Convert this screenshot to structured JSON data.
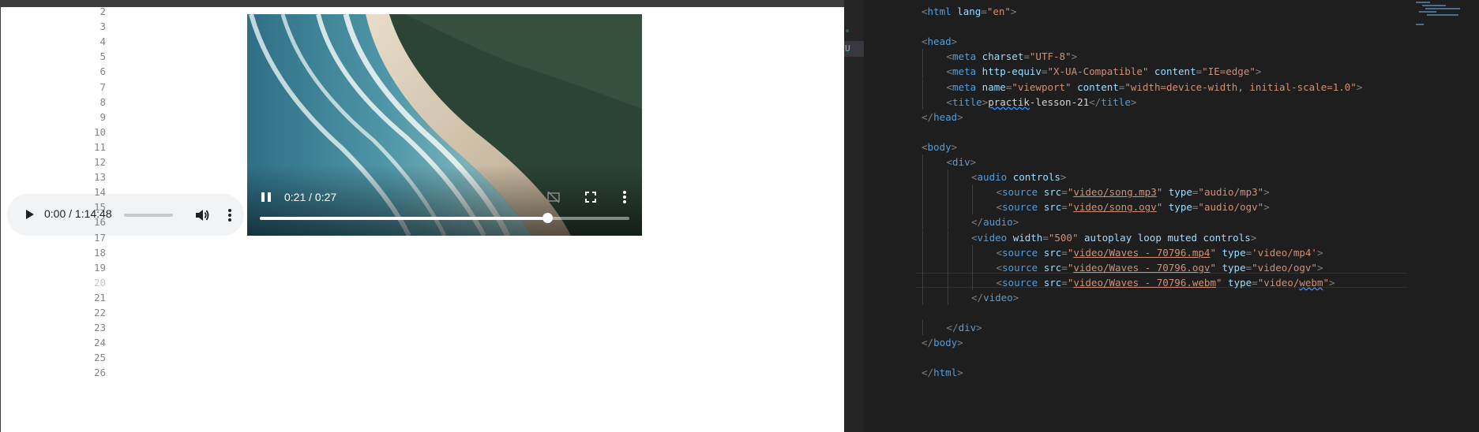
{
  "preview": {
    "audio": {
      "time": "0:00 / 1:14:48",
      "progress": 0
    },
    "video": {
      "time": "0:21 / 0:27",
      "progress": 0.7778
    }
  },
  "editor": {
    "gutter_badge": "U",
    "active_line": 20,
    "lines": [
      {
        "n": "2",
        "tokens": [
          [
            "br",
            "<"
          ],
          [
            "tag",
            "html"
          ],
          [
            "at",
            " lang"
          ],
          [
            "br",
            "="
          ],
          [
            "st",
            "\"en\""
          ],
          [
            "br",
            ">"
          ]
        ]
      },
      {
        "n": "3",
        "tokens": []
      },
      {
        "n": "4",
        "tokens": [
          [
            "br",
            "<"
          ],
          [
            "tag",
            "head"
          ],
          [
            "br",
            ">"
          ]
        ]
      },
      {
        "n": "5",
        "indent": 1,
        "tokens": [
          [
            "br",
            "<"
          ],
          [
            "tag",
            "meta"
          ],
          [
            "at",
            " charset"
          ],
          [
            "br",
            "="
          ],
          [
            "st",
            "\"UTF-8\""
          ],
          [
            "br",
            ">"
          ]
        ]
      },
      {
        "n": "6",
        "indent": 1,
        "tokens": [
          [
            "br",
            "<"
          ],
          [
            "tag",
            "meta"
          ],
          [
            "at",
            " http-equiv"
          ],
          [
            "br",
            "="
          ],
          [
            "st",
            "\"X-UA-Compatible\""
          ],
          [
            "at",
            " content"
          ],
          [
            "br",
            "="
          ],
          [
            "st",
            "\"IE=edge\""
          ],
          [
            "br",
            ">"
          ]
        ]
      },
      {
        "n": "7",
        "indent": 1,
        "tokens": [
          [
            "br",
            "<"
          ],
          [
            "tag",
            "meta"
          ],
          [
            "at",
            " name"
          ],
          [
            "br",
            "="
          ],
          [
            "st",
            "\"viewport\""
          ],
          [
            "at",
            " content"
          ],
          [
            "br",
            "="
          ],
          [
            "st",
            "\"width=device-width, initial-scale=1.0\""
          ],
          [
            "br",
            ">"
          ]
        ]
      },
      {
        "n": "8",
        "indent": 1,
        "tokens": [
          [
            "br",
            "<"
          ],
          [
            "tag",
            "title"
          ],
          [
            "br",
            ">"
          ],
          [
            "squig",
            "practik"
          ],
          [
            "txt",
            "-lesson-21"
          ],
          [
            "br",
            "</"
          ],
          [
            "tag",
            "title"
          ],
          [
            "br",
            ">"
          ]
        ]
      },
      {
        "n": "9",
        "tokens": [
          [
            "br",
            "</"
          ],
          [
            "tag",
            "head"
          ],
          [
            "br",
            ">"
          ]
        ]
      },
      {
        "n": "10",
        "tokens": []
      },
      {
        "n": "11",
        "tokens": [
          [
            "br",
            "<"
          ],
          [
            "tag",
            "body"
          ],
          [
            "br",
            ">"
          ]
        ]
      },
      {
        "n": "12",
        "indent": 1,
        "tokens": [
          [
            "br",
            "<"
          ],
          [
            "tag",
            "div"
          ],
          [
            "br",
            ">"
          ]
        ]
      },
      {
        "n": "13",
        "indent": 2,
        "tokens": [
          [
            "br",
            "<"
          ],
          [
            "tag",
            "audio"
          ],
          [
            "at",
            " controls"
          ],
          [
            "br",
            ">"
          ]
        ]
      },
      {
        "n": "14",
        "indent": 3,
        "tokens": [
          [
            "br",
            "<"
          ],
          [
            "tag",
            "source"
          ],
          [
            "at",
            " src"
          ],
          [
            "br",
            "="
          ],
          [
            "st",
            "\""
          ],
          [
            "link",
            "video/song.mp3"
          ],
          [
            "st",
            "\""
          ],
          [
            "at",
            " type"
          ],
          [
            "br",
            "="
          ],
          [
            "st",
            "\"audio/mp3\""
          ],
          [
            "br",
            ">"
          ]
        ]
      },
      {
        "n": "15",
        "indent": 3,
        "tokens": [
          [
            "br",
            "<"
          ],
          [
            "tag",
            "source"
          ],
          [
            "at",
            " src"
          ],
          [
            "br",
            "="
          ],
          [
            "st",
            "\""
          ],
          [
            "link",
            "video/song.ogv"
          ],
          [
            "st",
            "\""
          ],
          [
            "at",
            " type"
          ],
          [
            "br",
            "="
          ],
          [
            "st",
            "\"audio/ogv\""
          ],
          [
            "br",
            ">"
          ]
        ]
      },
      {
        "n": "16",
        "indent": 2,
        "tokens": [
          [
            "br",
            "</"
          ],
          [
            "tag",
            "audio"
          ],
          [
            "br",
            ">"
          ]
        ]
      },
      {
        "n": "17",
        "indent": 2,
        "tokens": [
          [
            "br",
            "<"
          ],
          [
            "tag",
            "video"
          ],
          [
            "at",
            " width"
          ],
          [
            "br",
            "="
          ],
          [
            "st",
            "\"500\""
          ],
          [
            "at",
            " autoplay loop muted controls"
          ],
          [
            "br",
            ">"
          ]
        ]
      },
      {
        "n": "18",
        "indent": 3,
        "tokens": [
          [
            "br",
            "<"
          ],
          [
            "tag",
            "source"
          ],
          [
            "at",
            " src"
          ],
          [
            "br",
            "="
          ],
          [
            "st",
            "\""
          ],
          [
            "link",
            "video/Waves - 70796.mp4"
          ],
          [
            "st",
            "\""
          ],
          [
            "at",
            " type"
          ],
          [
            "br",
            "="
          ],
          [
            "st",
            "'video/mp4'"
          ],
          [
            "br",
            ">"
          ]
        ]
      },
      {
        "n": "19",
        "indent": 3,
        "tokens": [
          [
            "br",
            "<"
          ],
          [
            "tag",
            "source"
          ],
          [
            "at",
            " src"
          ],
          [
            "br",
            "="
          ],
          [
            "st",
            "\""
          ],
          [
            "link",
            "video/Waves - 70796.ogv"
          ],
          [
            "st",
            "\""
          ],
          [
            "at",
            " type"
          ],
          [
            "br",
            "="
          ],
          [
            "st",
            "\"video/ogv\""
          ],
          [
            "br",
            ">"
          ]
        ]
      },
      {
        "n": "20",
        "indent": 3,
        "tokens": [
          [
            "br",
            "<"
          ],
          [
            "tag",
            "source"
          ],
          [
            "at",
            " src"
          ],
          [
            "br",
            "="
          ],
          [
            "st",
            "\""
          ],
          [
            "link",
            "video/Waves - 70796.webm"
          ],
          [
            "st",
            "\""
          ],
          [
            "at",
            " type"
          ],
          [
            "br",
            "="
          ],
          [
            "st",
            "\"video/"
          ],
          [
            "stsquig",
            "webm"
          ],
          [
            "st",
            "\""
          ],
          [
            "br",
            ">"
          ]
        ]
      },
      {
        "n": "21",
        "indent": 2,
        "tokens": [
          [
            "br",
            "</"
          ],
          [
            "tag",
            "video"
          ],
          [
            "br",
            ">"
          ]
        ]
      },
      {
        "n": "22",
        "tokens": []
      },
      {
        "n": "23",
        "indent": 1,
        "tokens": [
          [
            "br",
            "</"
          ],
          [
            "tag",
            "div"
          ],
          [
            "br",
            ">"
          ]
        ]
      },
      {
        "n": "24",
        "tokens": [
          [
            "br",
            "</"
          ],
          [
            "tag",
            "body"
          ],
          [
            "br",
            ">"
          ]
        ]
      },
      {
        "n": "25",
        "tokens": []
      },
      {
        "n": "26",
        "tokens": [
          [
            "br",
            "</"
          ],
          [
            "tag",
            "html"
          ],
          [
            "br",
            ">"
          ]
        ]
      }
    ]
  },
  "colors": {
    "editor_bg": "#1e1e1e",
    "tag": "#569cd6",
    "attribute": "#9cdcfe",
    "string": "#ce9178",
    "bracket": "#808080",
    "audio_bg": "#f1f3f4"
  },
  "icons": [
    "play-icon",
    "volume-icon",
    "more-vert-icon",
    "pause-icon",
    "no-cast-icon",
    "fullscreen-icon"
  ]
}
